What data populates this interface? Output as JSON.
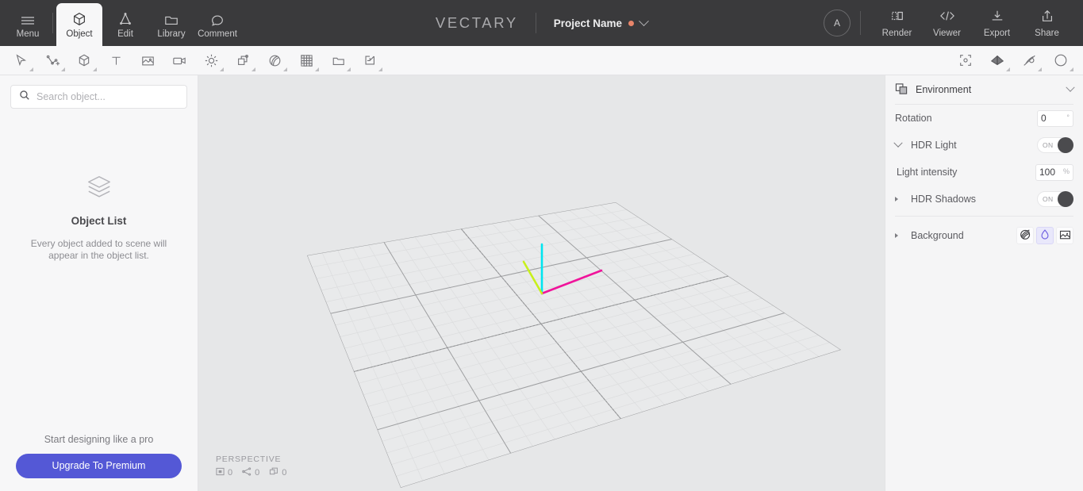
{
  "header": {
    "tabs": [
      {
        "label": "Menu",
        "icon": "hamburger-icon",
        "active": false
      },
      {
        "label": "Object",
        "icon": "cube-icon",
        "active": true
      },
      {
        "label": "Edit",
        "icon": "triangle-vertices-icon",
        "active": false
      },
      {
        "label": "Library",
        "icon": "folder-icon",
        "active": false
      },
      {
        "label": "Comment",
        "icon": "speech-bubble-icon",
        "active": false
      }
    ],
    "logo": "VECTARY",
    "project_name": "Project Name",
    "project_modified_dot_color": "#E8856A",
    "avatar_initial": "A",
    "actions": [
      {
        "label": "Render",
        "icon": "render-split-icon"
      },
      {
        "label": "Viewer",
        "icon": "code-brackets-icon"
      },
      {
        "label": "Export",
        "icon": "download-icon"
      },
      {
        "label": "Share",
        "icon": "share-upload-icon"
      }
    ]
  },
  "toolbar": {
    "left_tools": [
      {
        "name": "select-cursor-tool",
        "has_submenu": true
      },
      {
        "name": "add-vertex-tool",
        "has_submenu": true
      },
      {
        "name": "primitive-cube-tool",
        "has_submenu": true
      },
      {
        "name": "text-tool",
        "has_submenu": false
      },
      {
        "name": "image-tool",
        "has_submenu": false
      },
      {
        "name": "camera-tool",
        "has_submenu": false
      },
      {
        "name": "light-tool",
        "has_submenu": true
      },
      {
        "name": "duplicate-tool",
        "has_submenu": true
      },
      {
        "name": "material-tool",
        "has_submenu": true
      },
      {
        "name": "texture-checker-tool",
        "has_submenu": true
      },
      {
        "name": "folder-group-tool",
        "has_submenu": true
      },
      {
        "name": "import-tool",
        "has_submenu": true
      }
    ],
    "right_tools": [
      {
        "name": "focus-frame-tool",
        "has_submenu": false
      },
      {
        "name": "shading-tool",
        "has_submenu": true
      },
      {
        "name": "snap-disabled-tool",
        "has_submenu": true
      },
      {
        "name": "orbit-sphere-tool",
        "has_submenu": true
      }
    ]
  },
  "left_panel": {
    "search_placeholder": "Search object...",
    "search_value": "",
    "search_icon": "search-icon",
    "empty_icon": "layers-stack-icon",
    "empty_title": "Object List",
    "empty_description": "Every object added to scene will appear in the object list.",
    "upsell_text": "Start designing like a pro",
    "upsell_button": "Upgrade To Premium",
    "upsell_button_color": "#5458D6"
  },
  "viewport": {
    "background_color": "#E6E7E8",
    "camera_mode": "PERSPECTIVE",
    "counters": [
      {
        "icon": "vertices-icon",
        "value": "0"
      },
      {
        "icon": "edges-icon",
        "value": "0"
      },
      {
        "icon": "objects-icon",
        "value": "0"
      }
    ],
    "gizmo": {
      "x_axis_color": "#F0149B",
      "y_axis_color": "#00E5F0",
      "z_axis_color": "#C8F01C"
    }
  },
  "right_panel": {
    "icon": "environment-icon",
    "title": "Environment",
    "collapse_icon": "chevron-down-icon",
    "rows": [
      {
        "label": "Rotation",
        "value": "0",
        "unit": "°",
        "type": "number"
      },
      {
        "label": "HDR Light",
        "toggle": "ON",
        "type": "toggle",
        "expanded": true
      },
      {
        "label": "Light intensity",
        "value": "100",
        "unit": "%",
        "type": "number"
      },
      {
        "label": "HDR Shadows",
        "toggle": "ON",
        "type": "toggle",
        "expanded": false
      },
      {
        "label": "Background",
        "type": "segmented",
        "expanded": false
      }
    ],
    "background_options": [
      {
        "name": "hdr-sphere-icon",
        "selected": false
      },
      {
        "name": "color-droplet-icon",
        "selected": true
      },
      {
        "name": "image-icon",
        "selected": false
      }
    ],
    "selected_highlight_color": "#E9E8FB"
  }
}
